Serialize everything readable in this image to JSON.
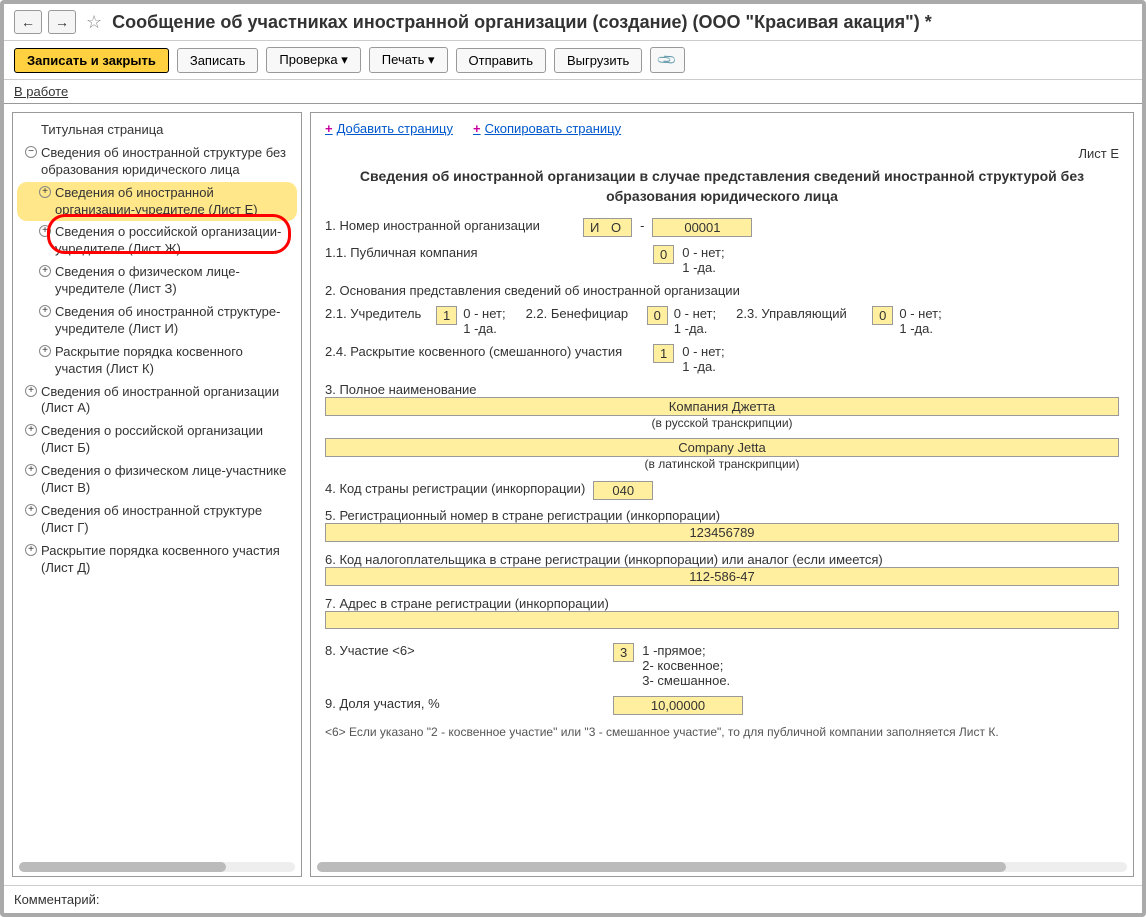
{
  "window": {
    "title": "Сообщение об участниках иностранной организации (создание) (ООО \"Красивая акация\") *"
  },
  "toolbar": {
    "save_close": "Записать и закрыть",
    "save": "Записать",
    "check": "Проверка",
    "print": "Печать",
    "send": "Отправить",
    "export": "Выгрузить"
  },
  "status": "В работе",
  "sidebar": {
    "items": [
      {
        "label": "Титульная страница",
        "expand": null
      },
      {
        "label": "Сведения об иностранной структуре без образования юридического лица",
        "expand": "-"
      },
      {
        "label": "Сведения об иностранной организации-учредителе (Лист Е)",
        "expand": "+",
        "level": 1,
        "selected": true
      },
      {
        "label": "Сведения о российской организации-учредителе (Лист Ж)",
        "expand": "+",
        "level": 1
      },
      {
        "label": "Сведения о физическом лице-учредителе (Лист З)",
        "expand": "+",
        "level": 1
      },
      {
        "label": "Сведения об иностранной структуре-учредителе (Лист И)",
        "expand": "+",
        "level": 1
      },
      {
        "label": "Раскрытие порядка косвенного участия (Лист К)",
        "expand": "+",
        "level": 1
      },
      {
        "label": "Сведения об иностранной организации (Лист А)",
        "expand": "+"
      },
      {
        "label": "Сведения о российской организации (Лист Б)",
        "expand": "+"
      },
      {
        "label": "Сведения о физическом лице-участнике (Лист В)",
        "expand": "+"
      },
      {
        "label": "Сведения об иностранной структуре (Лист Г)",
        "expand": "+"
      },
      {
        "label": "Раскрытие порядка косвенного участия (Лист Д)",
        "expand": "+"
      }
    ]
  },
  "content": {
    "add_page": "Добавить страницу",
    "copy_page": "Скопировать страницу",
    "sheet": "Лист Е",
    "title": "Сведения об иностранной организации в случае представления сведений иностранной структурой без образования юридического лица",
    "r1_label": "1. Номер иностранной организации",
    "r1_prefix": "И О",
    "r1_sep": "-",
    "r1_value": "00001",
    "r11_label": "1.1. Публичная компания",
    "r11_value": "0",
    "r11_hint": "0 - нет;\n1 -да.",
    "r2_label": "2. Основания представления сведений об иностранной организации",
    "r21_label": "2.1. Учредитель",
    "r21_value": "1",
    "r22_label": "2.2. Бенефициар",
    "r22_value": "0",
    "r23_label": "2.3. Управляющий",
    "r23_value": "0",
    "r2_hint": "0 - нет;\n1 -да.",
    "r24_label": "2.4. Раскрытие косвенного (смешанного) участия",
    "r24_value": "1",
    "r3_label": "3. Полное наименование",
    "r3_ru": "Компания Джетта",
    "r3_ru_hint": "(в русской транскрипции)",
    "r3_lat": "Company Jetta",
    "r3_lat_hint": "(в латинской транскрипции)",
    "r4_label": "4. Код страны регистрации (инкорпорации)",
    "r4_value": "040",
    "r5_label": "5. Регистрационный номер в стране регистрации (инкорпорации)",
    "r5_value": "123456789",
    "r6_label": "6. Код налогоплательщика в стране регистрации (инкорпорации) или аналог (если имеется)",
    "r6_value": "112-586-47",
    "r7_label": "7. Адрес в стране регистрации (инкорпорации)",
    "r7_value": "",
    "r8_label": "8. Участие <6>",
    "r8_value": "3",
    "r8_hint": "1 -прямое;\n2- косвенное;\n3- смешанное.",
    "r9_label": "9. Доля участия, %",
    "r9_value": "10,00000",
    "footnote": "<6>   Если указано \"2 - косвенное участие\" или \"3 - смешанное участие\", то для публичной компании заполняется Лист К."
  },
  "bottom": {
    "comment_label": "Комментарий:"
  }
}
